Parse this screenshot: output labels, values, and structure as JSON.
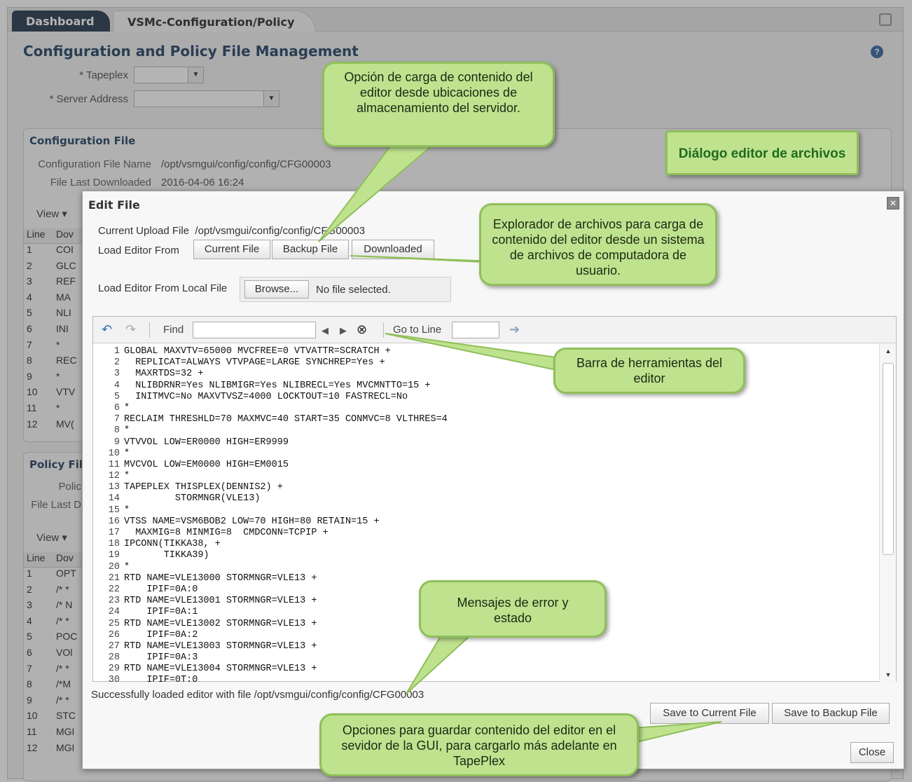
{
  "tabs": [
    "Dashboard",
    "VSMc-Configuration/Policy"
  ],
  "page": {
    "title": "Configuration and Policy File Management"
  },
  "filters": {
    "tapeplex_label": "Tapeplex",
    "server_label": "Server Address"
  },
  "config_section": {
    "title": "Configuration File",
    "name_label": "Configuration File Name",
    "name_value": "/opt/vsmgui/config/config/CFG00003",
    "downloaded_label": "File Last Downloaded",
    "downloaded_value": "2016-04-06 16:24",
    "view_label": "View",
    "col_line": "Line",
    "col_dov": "Dov",
    "rows": [
      {
        "n": "1",
        "v": "COI"
      },
      {
        "n": "2",
        "v": "GLC"
      },
      {
        "n": "3",
        "v": "REF"
      },
      {
        "n": "4",
        "v": "MA"
      },
      {
        "n": "5",
        "v": "NLI"
      },
      {
        "n": "6",
        "v": "INI"
      },
      {
        "n": "7",
        "v": "*"
      },
      {
        "n": "8",
        "v": "REC"
      },
      {
        "n": "9",
        "v": "*"
      },
      {
        "n": "10",
        "v": "VTV"
      },
      {
        "n": "11",
        "v": "*"
      },
      {
        "n": "12",
        "v": "MV("
      }
    ]
  },
  "policy_section": {
    "title": "Policy Fil",
    "name_label": "Polic",
    "downloaded_label": "File Last D",
    "view_label": "View",
    "col_line": "Line",
    "col_dov": "Dov",
    "rows": [
      {
        "n": "1",
        "v": "OPT"
      },
      {
        "n": "2",
        "v": "/* *"
      },
      {
        "n": "3",
        "v": "/* N"
      },
      {
        "n": "4",
        "v": "/* *"
      },
      {
        "n": "5",
        "v": "POC"
      },
      {
        "n": "6",
        "v": "VOl"
      },
      {
        "n": "7",
        "v": "/* *"
      },
      {
        "n": "8",
        "v": "/*M"
      },
      {
        "n": "9",
        "v": "/* *"
      },
      {
        "n": "10",
        "v": "STC"
      },
      {
        "n": "11",
        "v": "MGI"
      },
      {
        "n": "12",
        "v": "MGI"
      }
    ]
  },
  "dialog": {
    "title": "Edit File",
    "current_upload_label": "Current Upload File",
    "current_upload_value": "/opt/vsmgui/config/config/CFG00003",
    "load_from_label": "Load Editor From",
    "btn_current": "Current File",
    "btn_backup": "Backup File",
    "btn_downloaded": "Downloaded",
    "local_file_label": "Load Editor From Local File",
    "browse_label": "Browse...",
    "no_file": "No file selected.",
    "find_label": "Find",
    "goto_label": "Go to Line",
    "status": "Successfully loaded editor with file /opt/vsmgui/config/config/CFG00003",
    "save_current": "Save to Current File",
    "save_backup": "Save to Backup File",
    "close": "Close"
  },
  "code_lines": [
    {
      "n": "1",
      "t": "GLOBAL MAXVTV=65000 MVCFREE=0 VTVATTR=SCRATCH +"
    },
    {
      "n": "2",
      "t": "  REPLICAT=ALWAYS VTVPAGE=LARGE SYNCHREP=Yes +"
    },
    {
      "n": "3",
      "t": "  MAXRTDS=32 +"
    },
    {
      "n": "4",
      "t": "  NLIBDRNR=Yes NLIBMIGR=Yes NLIBRECL=Yes MVCMNTTO=15 +"
    },
    {
      "n": "5",
      "t": "  INITMVC=No MAXVTVSZ=4000 LOCKTOUT=10 FASTRECL=No"
    },
    {
      "n": "6",
      "t": "*"
    },
    {
      "n": "7",
      "t": "RECLAIM THRESHLD=70 MAXMVC=40 START=35 CONMVC=8 VLTHRES=4"
    },
    {
      "n": "8",
      "t": "*"
    },
    {
      "n": "9",
      "t": "VTVVOL LOW=ER0000 HIGH=ER9999"
    },
    {
      "n": "10",
      "t": "*"
    },
    {
      "n": "11",
      "t": "MVCVOL LOW=EM0000 HIGH=EM0015"
    },
    {
      "n": "12",
      "t": "*"
    },
    {
      "n": "13",
      "t": "TAPEPLEX THISPLEX(DENNIS2) +"
    },
    {
      "n": "14",
      "t": "         STORMNGR(VLE13)"
    },
    {
      "n": "15",
      "t": "*"
    },
    {
      "n": "16",
      "t": "VTSS NAME=VSM6BOB2 LOW=70 HIGH=80 RETAIN=15 +"
    },
    {
      "n": "17",
      "t": "  MAXMIG=8 MINMIG=8  CMDCONN=TCPIP +"
    },
    {
      "n": "18",
      "t": "IPCONN(TIKKA38, +"
    },
    {
      "n": "19",
      "t": "       TIKKA39)"
    },
    {
      "n": "20",
      "t": "*"
    },
    {
      "n": "21",
      "t": "RTD NAME=VLE13000 STORMNGR=VLE13 +"
    },
    {
      "n": "22",
      "t": "    IPIF=0A:0"
    },
    {
      "n": "23",
      "t": "RTD NAME=VLE13001 STORMNGR=VLE13 +"
    },
    {
      "n": "24",
      "t": "    IPIF=0A:1"
    },
    {
      "n": "25",
      "t": "RTD NAME=VLE13002 STORMNGR=VLE13 +"
    },
    {
      "n": "26",
      "t": "    IPIF=0A:2"
    },
    {
      "n": "27",
      "t": "RTD NAME=VLE13003 STORMNGR=VLE13 +"
    },
    {
      "n": "28",
      "t": "    IPIF=0A:3"
    },
    {
      "n": "29",
      "t": "RTD NAME=VLE13004 STORMNGR=VLE13 +"
    },
    {
      "n": "30",
      "t": "    IPIF=0T:0"
    }
  ],
  "callouts": {
    "dialog_title": "Diálogo editor de archivos",
    "server_load": "Opción de carga de contenido del editor desde ubicaciones de almacenamiento del servidor.",
    "file_browser": "Explorador de archivos para carga de contenido del editor desde un sistema de archivos de computadora de usuario.",
    "toolbar": "Barra de herramientas del editor",
    "messages": "Mensajes de error y estado",
    "save_options": "Opciones para guardar contenido del editor en el sevidor de la GUI, para cargarlo más adelante en TapePlex"
  },
  "colors": {
    "callout_fill": "#bfe28f",
    "callout_border": "#8fbf5a",
    "title_text": "#2b4a6b"
  }
}
